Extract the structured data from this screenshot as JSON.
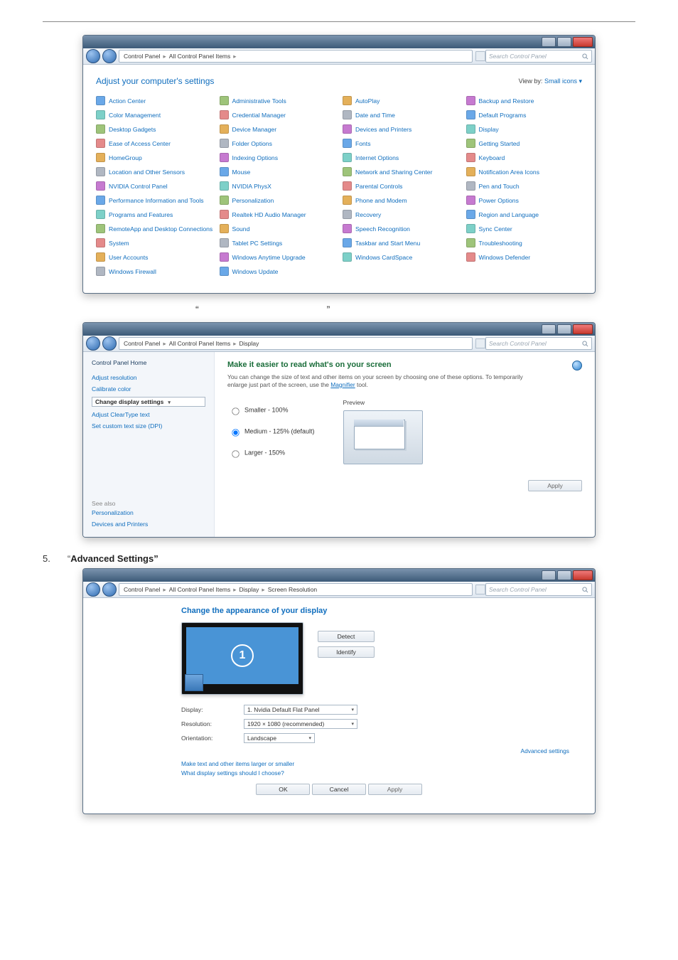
{
  "win1": {
    "breadcrumb": [
      "Control Panel",
      "All Control Panel Items"
    ],
    "search_ph": "Search Control Panel",
    "heading": "Adjust your computer's settings",
    "view_by_lbl": "View by:",
    "view_by_val": "Small icons ▾",
    "items": [
      "Action Center",
      "Administrative Tools",
      "AutoPlay",
      "Backup and Restore",
      "Color Management",
      "Credential Manager",
      "Date and Time",
      "Default Programs",
      "Desktop Gadgets",
      "Device Manager",
      "Devices and Printers",
      "Display",
      "Ease of Access Center",
      "Folder Options",
      "Fonts",
      "Getting Started",
      "HomeGroup",
      "Indexing Options",
      "Internet Options",
      "Keyboard",
      "Location and Other Sensors",
      "Mouse",
      "Network and Sharing Center",
      "Notification Area Icons",
      "NVIDIA Control Panel",
      "NVIDIA PhysX",
      "Parental Controls",
      "Pen and Touch",
      "Performance Information and Tools",
      "Personalization",
      "Phone and Modem",
      "Power Options",
      "Programs and Features",
      "Realtek HD Audio Manager",
      "Recovery",
      "Region and Language",
      "RemoteApp and Desktop Connections",
      "Sound",
      "Speech Recognition",
      "Sync Center",
      "System",
      "Tablet PC Settings",
      "Taskbar and Start Menu",
      "Troubleshooting",
      "User Accounts",
      "Windows Anytime Upgrade",
      "Windows CardSpace",
      "Windows Defender",
      "Windows Firewall",
      "Windows Update"
    ]
  },
  "mid_quotes": {
    "left": "“",
    "right": "”"
  },
  "win2": {
    "breadcrumb": [
      "Control Panel",
      "All Control Panel Items",
      "Display"
    ],
    "search_ph": "Search Control Panel",
    "side_hdr": "Control Panel Home",
    "side_links": [
      "Adjust resolution",
      "Calibrate color",
      "Change display settings",
      "Adjust ClearType text",
      "Set custom text size (DPI)"
    ],
    "see_also": "See also",
    "see_links": [
      "Personalization",
      "Devices and Printers"
    ],
    "title": "Make it easier to read what's on your screen",
    "desc_a": "You can change the size of text and other items on your screen by choosing one of these options. To temporarily enlarge just part of the screen, use the ",
    "desc_link": "Magnifier",
    "desc_b": " tool.",
    "opt_small": "Smaller - 100%",
    "opt_med": "Medium - 125% (default)",
    "opt_large": "Larger - 150%",
    "preview": "Preview",
    "apply": "Apply"
  },
  "step5": {
    "num": "5.",
    "pre": "“",
    "bold": "Advanced Settings”"
  },
  "win3": {
    "breadcrumb": [
      "Control Panel",
      "All Control Panel Items",
      "Display",
      "Screen Resolution"
    ],
    "search_ph": "Search Control Panel",
    "title": "Change the appearance of your display",
    "detect": "Detect",
    "identify": "Identify",
    "lbl_display": "Display:",
    "val_display": "1. Nvidia Default Flat Panel",
    "lbl_res": "Resolution:",
    "val_res": "1920 × 1080 (recommended)",
    "lbl_orient": "Orientation:",
    "val_orient": "Landscape",
    "advanced": "Advanced settings",
    "link1": "Make text and other items larger or smaller",
    "link2": "What display settings should I choose?",
    "ok": "OK",
    "cancel": "Cancel",
    "apply": "Apply",
    "mon_num": "1"
  }
}
